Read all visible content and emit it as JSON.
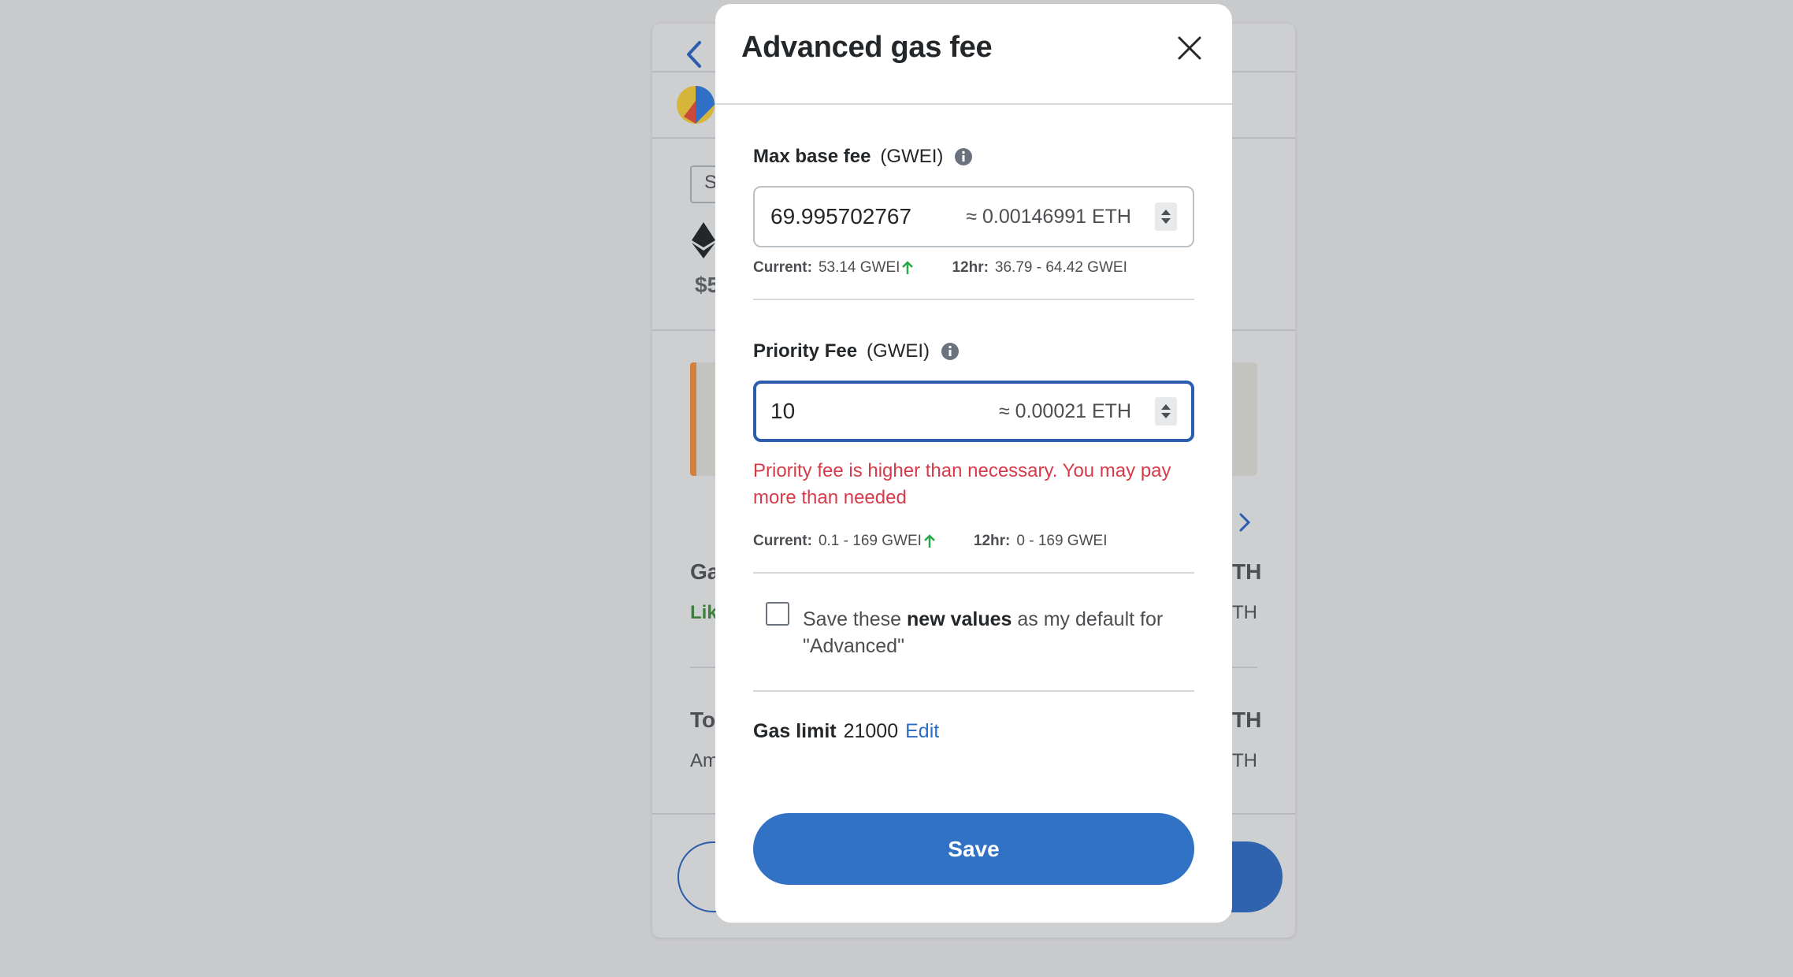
{
  "background": {
    "fragments": {
      "s_box": "S",
      "price": "$5",
      "gas": "Ga",
      "likely": "Lik",
      "eth1": "TH",
      "eth2": "TH",
      "total": "To",
      "eth3": "TH",
      "amount": "Am",
      "eth4": "TH"
    }
  },
  "modal": {
    "title": "Advanced gas fee",
    "max_base_fee": {
      "label": "Max base fee",
      "unit": "(GWEI)",
      "value": "69.995702767",
      "approx": "≈ 0.00146991 ETH",
      "current_label": "Current:",
      "current_value": "53.14 GWEI",
      "range_label": "12hr:",
      "range_value": "36.79 - 64.42 GWEI"
    },
    "priority_fee": {
      "label": "Priority Fee",
      "unit": "(GWEI)",
      "value": "10",
      "approx": "≈ 0.00021 ETH",
      "error": "Priority fee is higher than necessary. You may pay more than needed",
      "current_label": "Current:",
      "current_value": "0.1 - 169 GWEI",
      "range_label": "12hr:",
      "range_value": "0 - 169 GWEI"
    },
    "default_checkbox": {
      "checked": false,
      "text_before": "Save these ",
      "text_bold": "new values",
      "text_after": " as my default for \"Advanced\""
    },
    "gas_limit": {
      "label": "Gas limit",
      "value": "21000",
      "edit_label": "Edit"
    },
    "save_label": "Save"
  },
  "colors": {
    "overlay": "#c9cacc",
    "primary": "#3172c4",
    "focus_border": "#2b5cae",
    "error": "#d73a49",
    "trend_up": "#28a745",
    "warning_stripe": "#e8743b"
  }
}
